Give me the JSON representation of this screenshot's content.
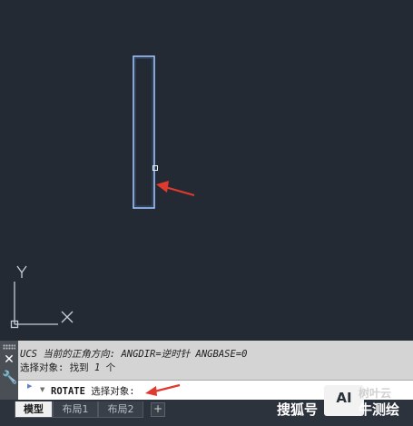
{
  "command_history": {
    "line1_prefix": "UCS 当前的正角方向:",
    "line1_angdir_key": "ANGDIR=",
    "line1_angdir_val": "逆时针",
    "line1_angbase": "ANGBASE=0",
    "line2_prefix": "选择对象: 找到",
    "line2_count": "1",
    "line2_suffix": "个"
  },
  "command_line": {
    "command": "ROTATE",
    "prompt": "选择对象:"
  },
  "tabs": [
    {
      "label": "模型",
      "active": true
    },
    {
      "label": "布局1",
      "active": false
    },
    {
      "label": "布局2",
      "active": false
    }
  ],
  "tab_add_label": "+",
  "ucs": {
    "y_label": "Y",
    "x_label": "X"
  },
  "watermark": {
    "text1": "搜狐号",
    "logo": "AI",
    "logo_label": "树叶云",
    "text2": "牛测绘"
  },
  "colors": {
    "canvas_bg": "#232a34",
    "rectangle_stroke": "#9fc4ff",
    "arrow": "#e03a2e",
    "ucs_icon": "#c9cdd2"
  },
  "icons": [
    "close-icon",
    "wrench-icon",
    "command-prompt-icon",
    "dropdown-icon",
    "red-arrow-icon"
  ]
}
